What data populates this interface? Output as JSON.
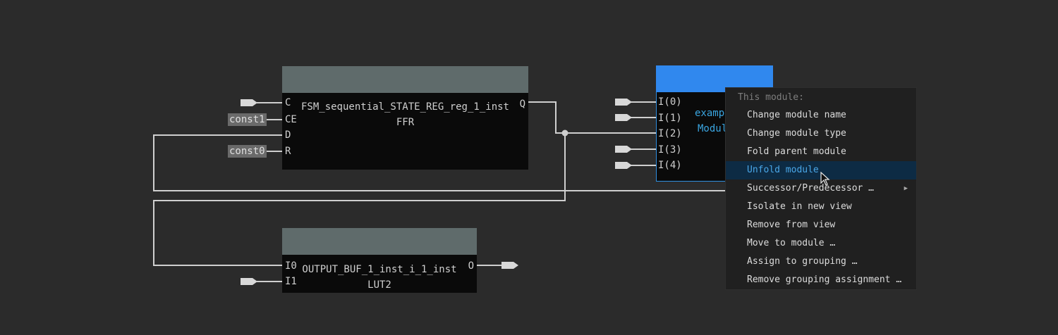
{
  "gates": {
    "ffr": {
      "name": "FSM_sequential_STATE_REG_reg_1_inst",
      "type": "FFR",
      "inputs": [
        "C",
        "CE",
        "D",
        "R"
      ],
      "outputs": [
        "Q"
      ]
    },
    "lut2": {
      "name": "OUTPUT_BUF_1_inst_i_1_inst",
      "type": "LUT2",
      "inputs": [
        "I0",
        "I1"
      ],
      "outputs": [
        "O"
      ]
    }
  },
  "module": {
    "name_partial": "exampl",
    "type_partial": "Modul",
    "inputs": [
      "I(0)",
      "I(1)",
      "I(2)",
      "I(3)",
      "I(4)"
    ]
  },
  "constants": [
    "const1",
    "const0"
  ],
  "context_menu": {
    "section": "This module:",
    "items": [
      "Change module name",
      "Change module type",
      "Fold parent module",
      "Unfold module",
      "Successor/Predecessor …",
      "Isolate in new view",
      "Remove from view",
      "Move to module …",
      "Assign to grouping …",
      "Remove grouping assignment …"
    ],
    "highlighted": "Unfold module"
  },
  "colors": {
    "background": "#2b2b2b",
    "gate_header": "#5f6b6b",
    "module_header": "#3088ee",
    "module_text": "#3aa5e0",
    "menu_highlight": "#0d2b44"
  }
}
